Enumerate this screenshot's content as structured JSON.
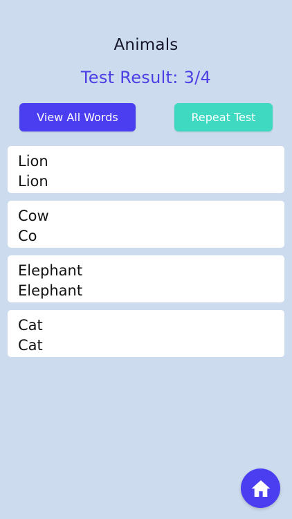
{
  "header": {
    "title": "Animals",
    "result": "Test Result: 3/4"
  },
  "buttons": {
    "view_all": "View All Words",
    "repeat": "Repeat Test"
  },
  "words": [
    {
      "word": "Lion",
      "answer": "Lion"
    },
    {
      "word": "Cow",
      "answer": "Co"
    },
    {
      "word": "Elephant",
      "answer": "Elephant"
    },
    {
      "word": "Cat",
      "answer": "Cat"
    }
  ],
  "colors": {
    "background": "#ccdcee",
    "primary": "#4b3df0",
    "accent": "#3fd9c2",
    "result_text": "#4d3fe3"
  },
  "icons": {
    "home": "home-icon"
  }
}
